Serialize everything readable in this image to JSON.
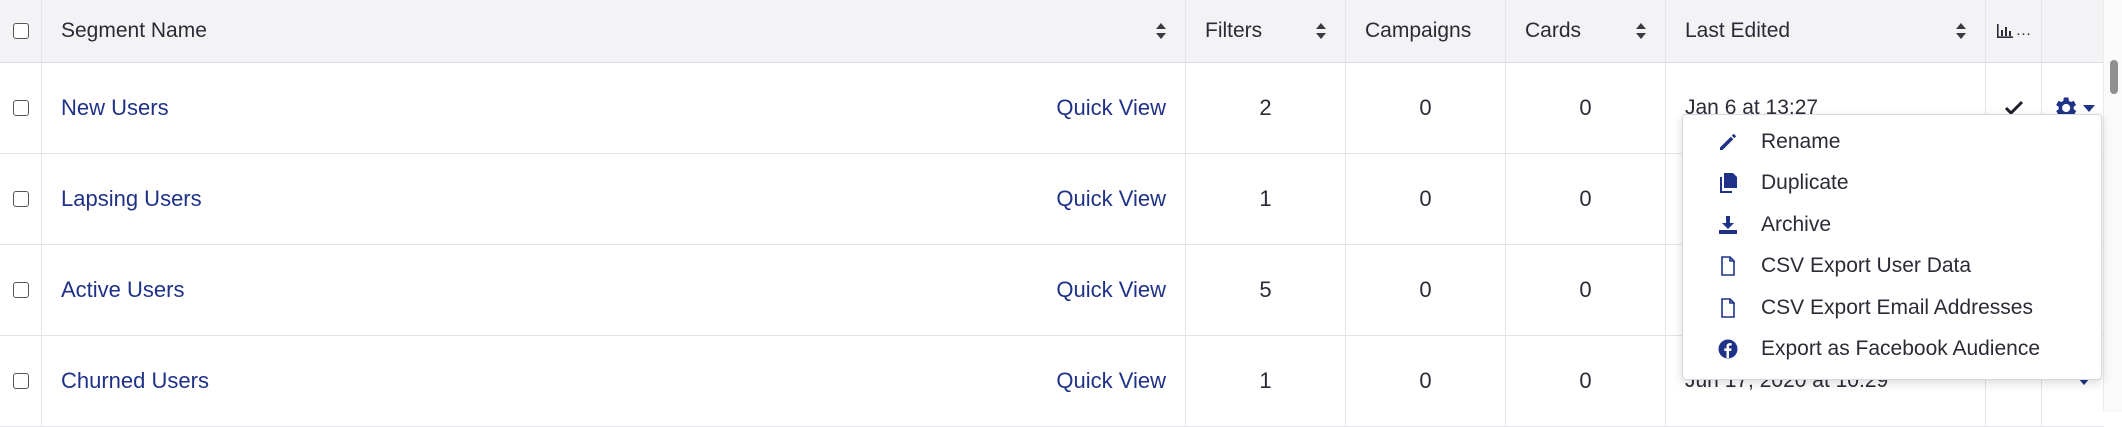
{
  "table": {
    "headers": {
      "name": "Segment Name",
      "filters": "Filters",
      "campaigns": "Campaigns",
      "cards": "Cards",
      "last_edited": "Last Edited",
      "stats": "…"
    },
    "quick_view_label": "Quick View",
    "rows": [
      {
        "name": "New Users",
        "filters": "2",
        "campaigns": "0",
        "cards": "0",
        "last_edited": "Jan 6 at 13:27"
      },
      {
        "name": "Lapsing Users",
        "filters": "1",
        "campaigns": "0",
        "cards": "0",
        "last_edited": ""
      },
      {
        "name": "Active Users",
        "filters": "5",
        "campaigns": "0",
        "cards": "0",
        "last_edited": ""
      },
      {
        "name": "Churned Users",
        "filters": "1",
        "campaigns": "0",
        "cards": "0",
        "last_edited": "Jun 17, 2020 at 10:29"
      }
    ]
  },
  "menu": {
    "items": [
      {
        "label": "Rename",
        "icon": "pencil-icon"
      },
      {
        "label": "Duplicate",
        "icon": "copy-icon"
      },
      {
        "label": "Archive",
        "icon": "download-icon"
      },
      {
        "label": "CSV Export User Data",
        "icon": "file-icon"
      },
      {
        "label": "CSV Export Email Addresses",
        "icon": "file-icon"
      },
      {
        "label": "Export as Facebook Audience",
        "icon": "facebook-icon"
      }
    ]
  },
  "colors": {
    "link": "#1f3287",
    "header_bg": "#f3f3f5",
    "border": "#e4e4e8"
  }
}
